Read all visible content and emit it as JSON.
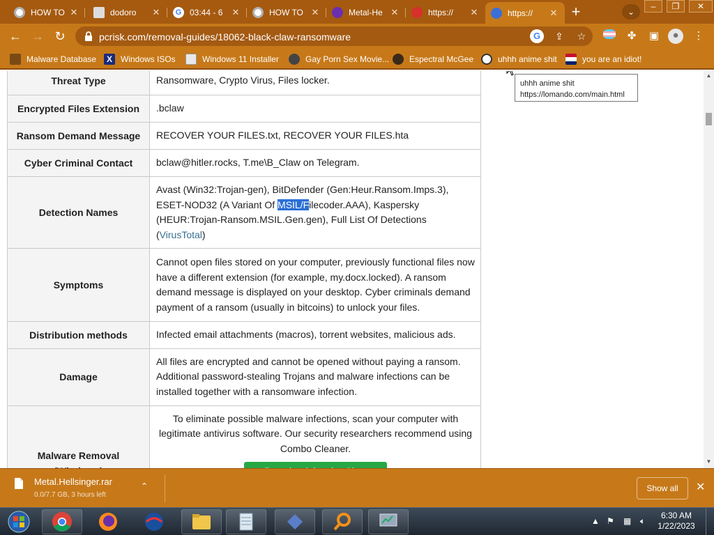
{
  "browser": {
    "tabs": [
      {
        "title": "HOW TO"
      },
      {
        "title": "dodoro"
      },
      {
        "title": "03:44 - 6"
      },
      {
        "title": "HOW TO"
      },
      {
        "title": "Metal-He"
      },
      {
        "title": "https://"
      },
      {
        "title": "https://"
      }
    ],
    "window_buttons": {
      "minimize": "–",
      "restore": "❐",
      "close": "✕"
    },
    "address": "pcrisk.com/removal-guides/18062-black-claw-ransomware",
    "bookmarks": [
      {
        "label": "Malware Database"
      },
      {
        "label": "Windows ISOs"
      },
      {
        "label": "Windows 11 Installer"
      },
      {
        "label": "Gay Porn Sex Movie..."
      },
      {
        "label": "Espectral McGee"
      },
      {
        "label": "uhhh anime shit"
      },
      {
        "label": "you are an idiot!"
      }
    ],
    "tooltip": {
      "line1": "uhhh anime shit",
      "line2": "https://lomando.com/main.html"
    }
  },
  "table": {
    "threat_type": {
      "label": "Threat Type",
      "value": "Ransomware, Crypto Virus, Files locker."
    },
    "extension": {
      "label": "Encrypted Files Extension",
      "value": ".bclaw"
    },
    "ransom_message": {
      "label": "Ransom Demand Message",
      "value": "RECOVER YOUR FILES.txt, RECOVER YOUR FILES.hta"
    },
    "contact": {
      "label": "Cyber Criminal Contact",
      "value": "bclaw@hitler.rocks, T.me\\B_Claw on Telegram."
    },
    "detection": {
      "label": "Detection Names",
      "part1": "Avast (Win32:Trojan-gen), BitDefender (Gen:Heur.Ransom.Imps.3), ESET-NOD32 (A Variant Of ",
      "selected": "MSIL/F",
      "part2": "ilecoder.AAA), Kaspersky (HEUR:Trojan-Ransom.MSIL.Gen.gen), Full List Of Detections (",
      "link": "VirusTotal",
      "part3": ")"
    },
    "symptoms": {
      "label": "Symptoms",
      "value": "Cannot open files stored on your computer, previously functional files now have a different extension (for example, my.docx.locked). A ransom demand message is displayed on your desktop. Cyber criminals demand payment of a ransom (usually in bitcoins) to unlock your files."
    },
    "distribution": {
      "label": "Distribution methods",
      "value": "Infected email attachments (macros), torrent websites, malicious ads."
    },
    "damage": {
      "label": "Damage",
      "value": "All files are encrypted and cannot be opened without paying a ransom. Additional password-stealing Trojans and malware infections can be installed together with a ransomware infection."
    },
    "removal": {
      "label": "Malware Removal (Windows)",
      "value": "To eliminate possible malware infections, scan your computer with legitimate antivirus software. Our security researchers recommend using Combo Cleaner.",
      "button": "▼ Download Combo Cleaner"
    }
  },
  "download": {
    "filename": "Metal.Hellsinger.rar",
    "status": "0.0/7.7 GB, 3 hours left",
    "show_all": "Show all"
  },
  "taskbar": {
    "time": "6:30 AM",
    "date": "1/22/2023"
  },
  "colors": {
    "theme": "#c77919",
    "tab_strip": "#a55a10",
    "download_button": "#28a745",
    "selection": "#2b6fd6"
  }
}
